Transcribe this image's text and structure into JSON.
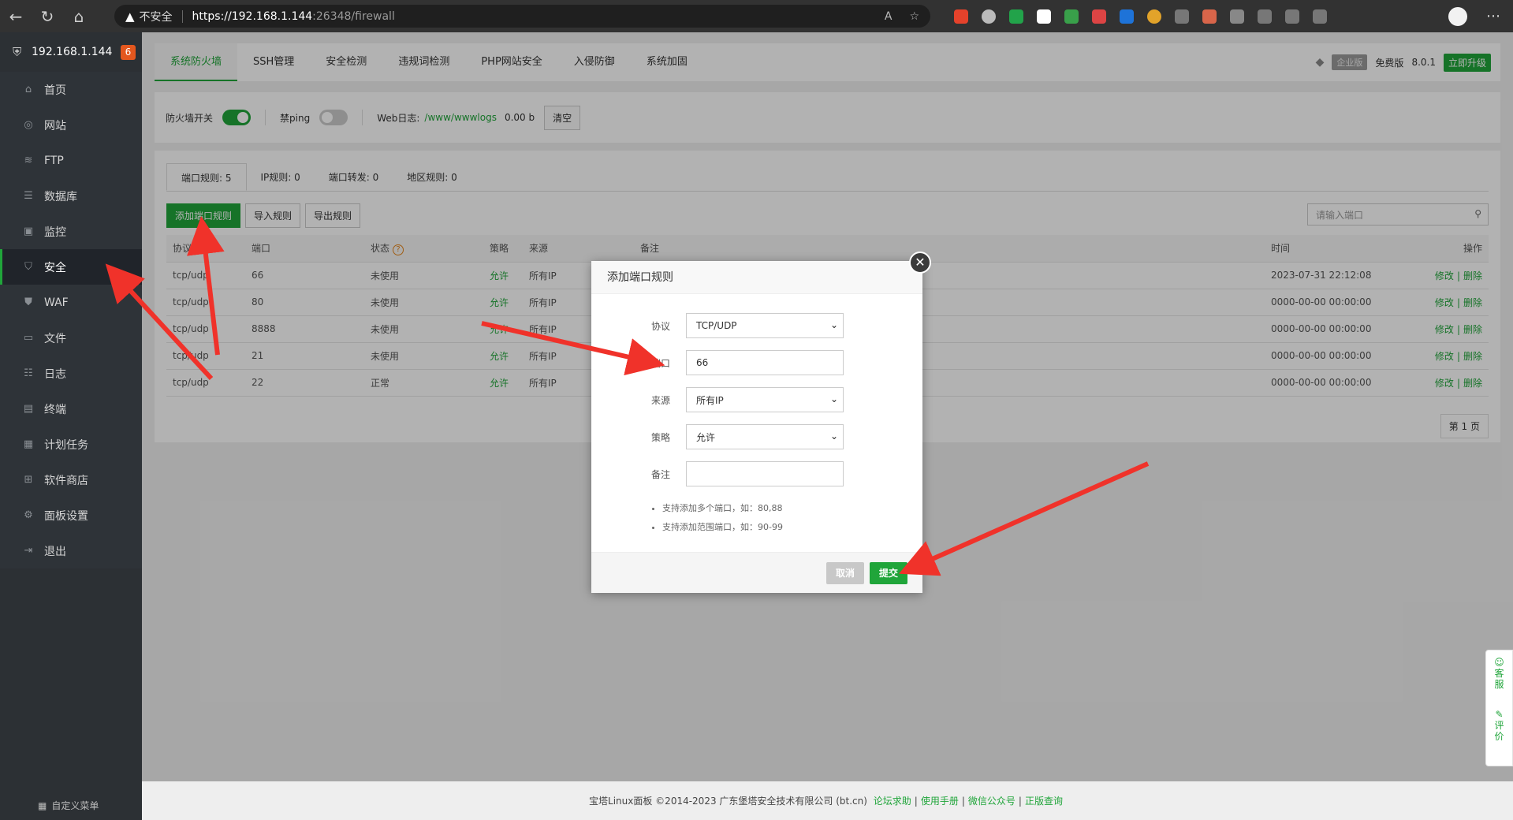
{
  "browser": {
    "security_label": "不安全",
    "url_protocol": "https",
    "url_host": "://192.168.1.144",
    "url_path": ":26348/firewall"
  },
  "sidebar": {
    "host": "192.168.1.144",
    "badge": "6",
    "items": [
      {
        "label": "首页",
        "icon": "home-icon"
      },
      {
        "label": "网站",
        "icon": "globe-icon"
      },
      {
        "label": "FTP",
        "icon": "ftp-icon"
      },
      {
        "label": "数据库",
        "icon": "database-icon"
      },
      {
        "label": "监控",
        "icon": "monitor-icon"
      },
      {
        "label": "安全",
        "icon": "shield-icon"
      },
      {
        "label": "WAF",
        "icon": "waf-shield-icon"
      },
      {
        "label": "文件",
        "icon": "folder-icon"
      },
      {
        "label": "日志",
        "icon": "log-icon"
      },
      {
        "label": "终端",
        "icon": "terminal-icon"
      },
      {
        "label": "计划任务",
        "icon": "calendar-icon"
      },
      {
        "label": "软件商店",
        "icon": "grid-icon"
      },
      {
        "label": "面板设置",
        "icon": "gear-icon"
      },
      {
        "label": "退出",
        "icon": "logout-icon"
      }
    ],
    "footer_label": "自定义菜单"
  },
  "topnav": {
    "tabs": [
      "系统防火墙",
      "SSH管理",
      "安全检测",
      "违规词检测",
      "PHP网站安全",
      "入侵防御",
      "系统加固"
    ],
    "enterprise": "企业版",
    "free": "免费版",
    "version": "8.0.1",
    "upgrade": "立即升级"
  },
  "fwbar": {
    "firewall_switch": "防火墙开关",
    "ping_label": "禁ping",
    "weblog_label": "Web日志:",
    "weblog_path": "/www/wwwlogs",
    "weblog_size": "0.00 b",
    "clear": "清空"
  },
  "subtabs": [
    "端口规则: 5",
    "IP规则: 0",
    "端口转发: 0",
    "地区规则: 0"
  ],
  "actions": {
    "add": "添加端口规则",
    "import": "导入规则",
    "export": "导出规则",
    "search_placeholder": "请输入端口"
  },
  "table": {
    "headers": [
      "协议",
      "端口",
      "状态",
      "策略",
      "来源",
      "备注",
      "时间",
      "操作"
    ],
    "rows": [
      {
        "proto": "tcp/udp",
        "port": "66",
        "status": "未使用",
        "policy": "允许",
        "source": "所有IP",
        "time": "2023-07-31 22:12:08"
      },
      {
        "proto": "tcp/udp",
        "port": "80",
        "status": "未使用",
        "policy": "允许",
        "source": "所有IP",
        "time": "0000-00-00 00:00:00"
      },
      {
        "proto": "tcp/udp",
        "port": "8888",
        "status": "未使用",
        "policy": "允许",
        "source": "所有IP",
        "time": "0000-00-00 00:00:00"
      },
      {
        "proto": "tcp/udp",
        "port": "21",
        "status": "未使用",
        "policy": "允许",
        "source": "所有IP",
        "time": "0000-00-00 00:00:00"
      },
      {
        "proto": "tcp/udp",
        "port": "22",
        "status": "正常",
        "policy": "允许",
        "source": "所有IP",
        "time": "0000-00-00 00:00:00"
      }
    ],
    "edit": "修改",
    "delete": "删除",
    "op_sep": "|",
    "pager": "第 1 页"
  },
  "dialog": {
    "title": "添加端口规则",
    "protocol_label": "协议",
    "protocol_value": "TCP/UDP",
    "port_label": "端口",
    "port_value": "66",
    "source_label": "来源",
    "source_value": "所有IP",
    "policy_label": "策略",
    "policy_value": "允许",
    "note_label": "备注",
    "note_value": "",
    "hint1": "支持添加多个端口，如：80,88",
    "hint2": "支持添加范围端口，如：90-99",
    "cancel": "取消",
    "submit": "提交"
  },
  "footer": {
    "copyright": "宝塔Linux面板 ©2014-2023 广东堡塔安全技术有限公司 (bt.cn)",
    "links": [
      "论坛求助",
      "使用手册",
      "微信公众号",
      "正版查询"
    ],
    "sep": "|"
  },
  "float": {
    "service": [
      "客",
      "服"
    ],
    "review": [
      "评",
      "价"
    ]
  },
  "colors": {
    "accent": "#20a53a",
    "annotation_arrow": "#f0322a"
  }
}
